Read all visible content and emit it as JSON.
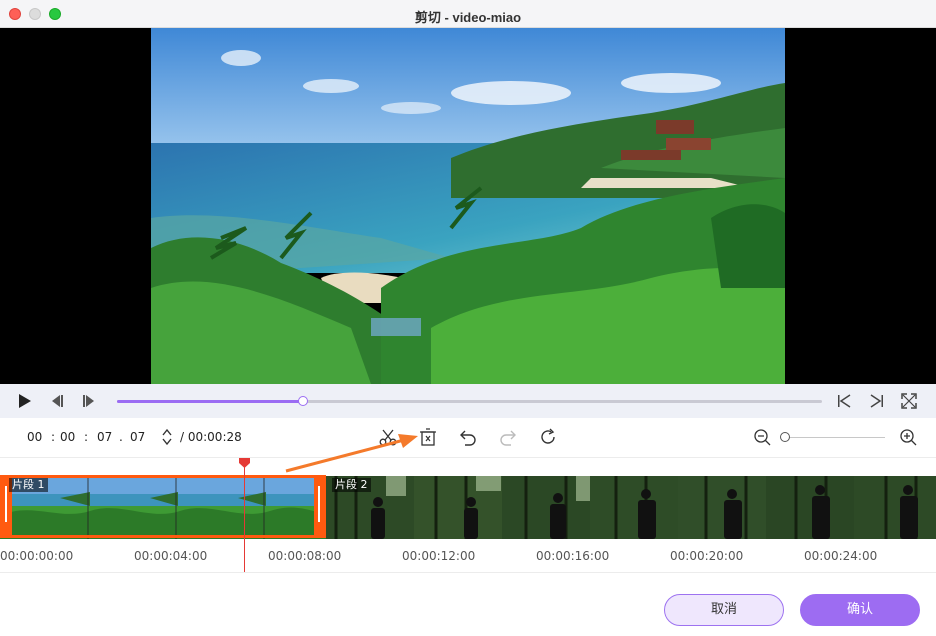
{
  "window": {
    "title": "剪切 - video-miao"
  },
  "player": {
    "progress": 0.264,
    "controls": [
      "play-icon",
      "prev-frame-icon",
      "next-frame-icon",
      "go-start-icon",
      "go-end-icon",
      "fullscreen-icon"
    ]
  },
  "time_input": {
    "hours": "00",
    "minutes": "00",
    "seconds": "07",
    "frames": "07",
    "total": "/ 00:00:28"
  },
  "toolbar": {
    "tools": [
      "scissors-icon",
      "delete-segment-icon",
      "undo-icon",
      "redo-icon",
      "reset-icon"
    ],
    "zoom_level": 0
  },
  "timeline": {
    "segments": [
      {
        "label": "片段 1",
        "selected": true
      },
      {
        "label": "片段 2",
        "selected": false
      }
    ],
    "ruler": [
      "00:00:00:00",
      "00:00:04:00",
      "00:00:08:00",
      "00:00:12:00",
      "00:00:16:00",
      "00:00:20:00",
      "00:00:24:00"
    ],
    "colors": {
      "selection": "#ff5a10",
      "playhead": "#e53935"
    }
  },
  "footer": {
    "cancel_label": "取消",
    "confirm_label": "确认"
  },
  "colors": {
    "accent": "#9d6cf2",
    "annotation_arrow": "#f47a2b"
  }
}
